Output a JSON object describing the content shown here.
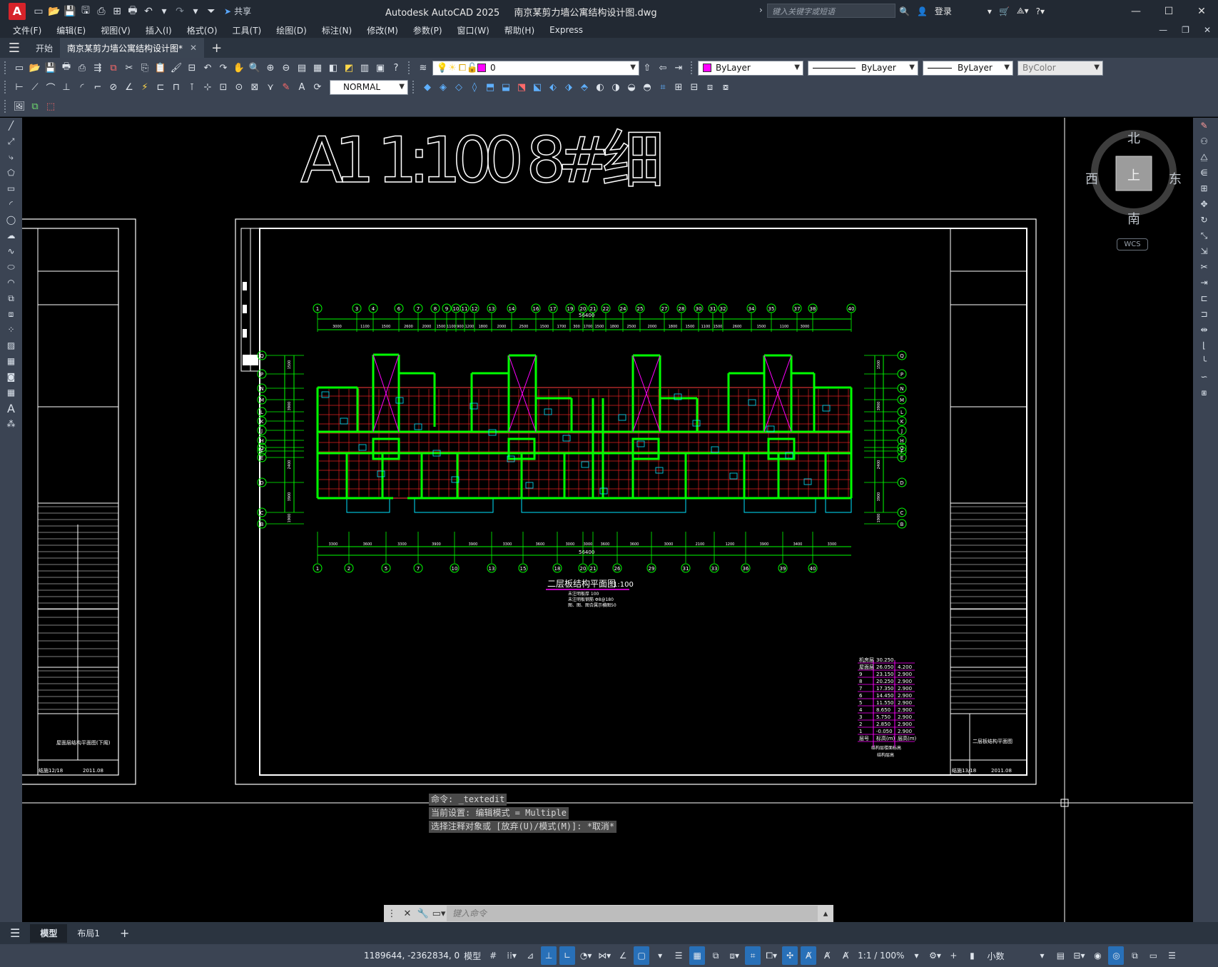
{
  "titlebar": {
    "app": "Autodesk AutoCAD 2025",
    "file": "南京某剪力墙公寓结构设计图.dwg",
    "share": "共享",
    "search_placeholder": "键入关键字或短语",
    "login": "登录"
  },
  "menu": [
    "文件(F)",
    "编辑(E)",
    "视图(V)",
    "插入(I)",
    "格式(O)",
    "工具(T)",
    "绘图(D)",
    "标注(N)",
    "修改(M)",
    "参数(P)",
    "窗口(W)",
    "帮助(H)",
    "Express"
  ],
  "tabs": {
    "start": "开始",
    "file": "南京某剪力墙公寓结构设计图*"
  },
  "toolbar": {
    "layer_value": "0",
    "color_value": "ByLayer",
    "linetype_value": "ByLayer",
    "lineweight_value": "ByLayer",
    "plotstyle_value": "ByColor",
    "dimstyle_value": "NORMAL"
  },
  "viewcube": {
    "north": "北",
    "south": "南",
    "east": "东",
    "west": "西",
    "top": "上",
    "wcs": "WCS"
  },
  "drawing": {
    "big_label": "A1 1:100 8#细",
    "plan_title": "二层板结构平面图",
    "plan_scale": "1:100",
    "notes": [
      "未注明板厚 100",
      "未注明板钢筋 Φ8@180",
      "图、图、图合属示横图50"
    ],
    "overall_dim": "56400",
    "axes_top": [
      "1",
      "3",
      "4",
      "6",
      "7",
      "8",
      "9",
      "10",
      "11",
      "12",
      "13",
      "14",
      "16",
      "17",
      "19",
      "20",
      "21",
      "22",
      "24",
      "25",
      "27",
      "28",
      "30",
      "31",
      "32",
      "34",
      "35",
      "37",
      "38",
      "40"
    ],
    "axes_bottom": [
      "1",
      "2",
      "5",
      "7",
      "10",
      "13",
      "15",
      "18",
      "20",
      "21",
      "26",
      "29",
      "31",
      "33",
      "36",
      "39",
      "40"
    ],
    "axes_rows": [
      "Q",
      "P",
      "N",
      "M",
      "L",
      "K",
      "J",
      "H",
      "G",
      "F",
      "E",
      "D",
      "C",
      "B",
      "A"
    ],
    "top_dims": [
      "3000",
      "1100",
      "1500",
      "2600",
      "2000",
      "1500",
      "1100",
      "900",
      "1200",
      "1800",
      "2000",
      "2500",
      "1500",
      "1700",
      "300",
      "1700",
      "1500",
      "1800",
      "2500",
      "2000",
      "1800",
      "1500",
      "1100",
      "1500",
      "2600",
      "1500",
      "1100",
      "3000"
    ],
    "bottom_dims": [
      "3300",
      "3600",
      "3300",
      "3900",
      "3900",
      "3300",
      "3600",
      "3000",
      "3000",
      "3600",
      "3600",
      "3000",
      "2100",
      "1200",
      "3900",
      "3400",
      "3300"
    ],
    "left_dims": [
      "1500",
      "3900",
      "2400",
      "3900",
      "1900"
    ],
    "left_sheet_title": "屋面层结构平面图(下阁)",
    "left_sheet_no": "结施12/18",
    "left_sheet_date": "2011.08",
    "right_sheet_title": "二层板结构平面图",
    "right_sheet_no": "结施13/18",
    "right_sheet_date": "2011.08",
    "level_table": {
      "rows": [
        [
          "机房层",
          "30.250",
          ""
        ],
        [
          "屋面层",
          "26.050",
          "4.200"
        ],
        [
          "9",
          "23.150",
          "2.900"
        ],
        [
          "8",
          "20.250",
          "2.900"
        ],
        [
          "7",
          "17.350",
          "2.900"
        ],
        [
          "6",
          "14.450",
          "2.900"
        ],
        [
          "5",
          "11.550",
          "2.900"
        ],
        [
          "4",
          "8.650",
          "2.900"
        ],
        [
          "3",
          "5.750",
          "2.900"
        ],
        [
          "2",
          "2.850",
          "2.900"
        ],
        [
          "1",
          "-0.050",
          "2.900"
        ],
        [
          "层号",
          "标高(m)",
          "层高(m)"
        ]
      ],
      "caption": "结构层楼面标高",
      "subcaption": "结构层高"
    }
  },
  "command": {
    "line1": "命令: _textedit",
    "line2": "当前设置: 编辑模式 = Multiple",
    "line3": "选择注释对象或 [放弃(U)/模式(M)]: *取消*",
    "placeholder": "键入命令"
  },
  "layout_tabs": [
    "模型",
    "布局1"
  ],
  "status": {
    "coords": "1189644, -2362834, 0",
    "mode": "模型",
    "scale": "1:1 / 100%",
    "units": "小数"
  }
}
